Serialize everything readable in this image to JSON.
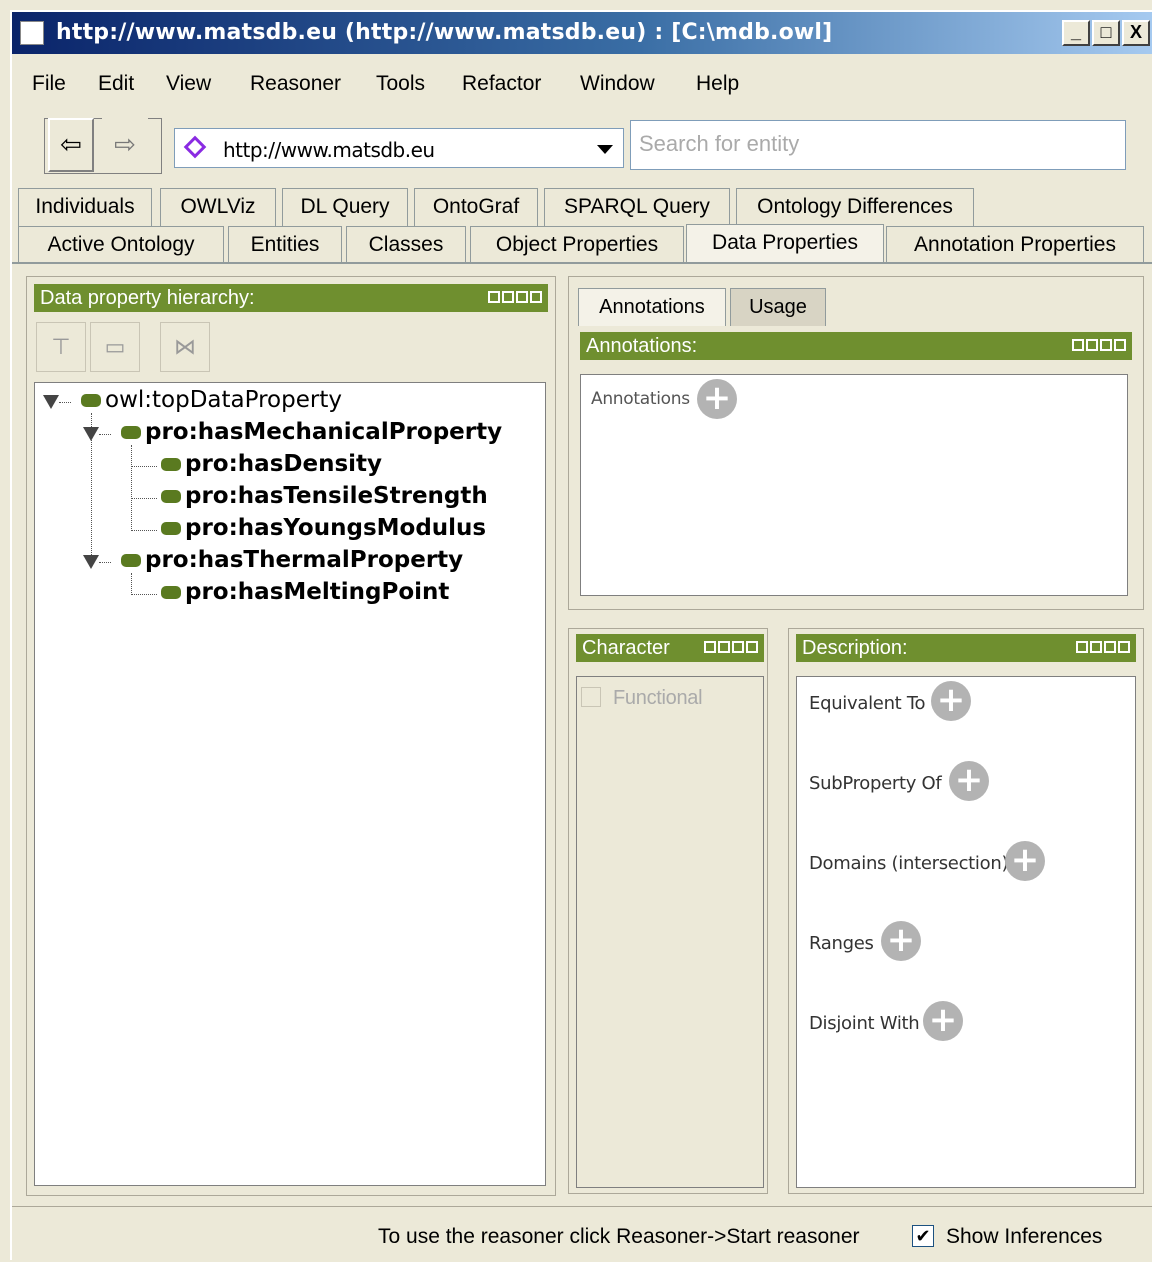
{
  "window": {
    "title": "http://www.matsdb.eu (http://www.matsdb.eu) : [C:\\mdb.owl]",
    "min": "_",
    "max": "□",
    "close": "X"
  },
  "menu": [
    "File",
    "Edit",
    "View",
    "Reasoner",
    "Tools",
    "Refactor",
    "Window",
    "Help"
  ],
  "toolbar": {
    "back": "⇦",
    "forward": "⇨",
    "ontology_url": "http://www.matsdb.eu",
    "search_placeholder": "Search for entity"
  },
  "tabs_row1": [
    "Individuals",
    "OWLViz",
    "DL Query",
    "OntoGraf",
    "SPARQL Query",
    "Ontology Differences"
  ],
  "tabs_row2": [
    "Active Ontology",
    "Entities",
    "Classes",
    "Object Properties",
    "Data Properties",
    "Annotation Properties"
  ],
  "hierarchy": {
    "title": "Data property hierarchy:",
    "items": [
      "owl:topDataProperty",
      "pro:hasMechanicalProperty",
      "pro:hasDensity",
      "pro:hasTensileStrength",
      "pro:hasYoungsModulus",
      "pro:hasThermalProperty",
      "pro:hasMeltingPoint"
    ]
  },
  "annotations": {
    "tabs": [
      "Annotations",
      "Usage"
    ],
    "header": "Annotations:",
    "label": "Annotations"
  },
  "characteristics": {
    "header": "Character",
    "functional": "Functional"
  },
  "description": {
    "header": "Description:",
    "sections": [
      "Equivalent To",
      "SubProperty Of",
      "Domains (intersection)",
      "Ranges",
      "Disjoint With"
    ]
  },
  "status": {
    "message": "To use the reasoner click Reasoner->Start reasoner",
    "check_mark": "✔",
    "show_inferences": "Show Inferences"
  }
}
